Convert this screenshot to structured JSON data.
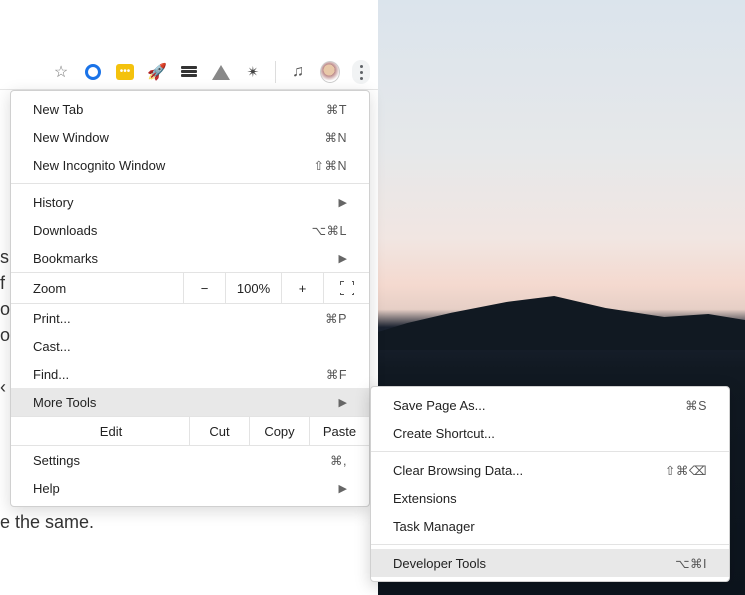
{
  "menu": {
    "new_tab": "New Tab",
    "new_tab_sc": "⌘T",
    "new_window": "New Window",
    "new_window_sc": "⌘N",
    "incognito": "New Incognito Window",
    "incognito_sc": "⇧⌘N",
    "history": "History",
    "downloads": "Downloads",
    "downloads_sc": "⌥⌘L",
    "bookmarks": "Bookmarks",
    "zoom": "Zoom",
    "zoom_minus": "−",
    "zoom_val": "100%",
    "zoom_plus": "+",
    "print": "Print...",
    "print_sc": "⌘P",
    "cast": "Cast...",
    "find": "Find...",
    "find_sc": "⌘F",
    "more_tools": "More Tools",
    "edit": "Edit",
    "cut": "Cut",
    "copy": "Copy",
    "paste": "Paste",
    "settings": "Settings",
    "settings_sc": "⌘,",
    "help": "Help"
  },
  "submenu": {
    "save_as": "Save Page As...",
    "save_as_sc": "⌘S",
    "create_shortcut": "Create Shortcut...",
    "clear_data": "Clear Browsing Data...",
    "clear_data_sc": "⇧⌘⌫",
    "extensions": "Extensions",
    "task_manager": "Task Manager",
    "dev_tools": "Developer Tools",
    "dev_tools_sc": "⌥⌘I"
  },
  "page_fragment": "e the same.",
  "toolbar_yellow": "•••"
}
